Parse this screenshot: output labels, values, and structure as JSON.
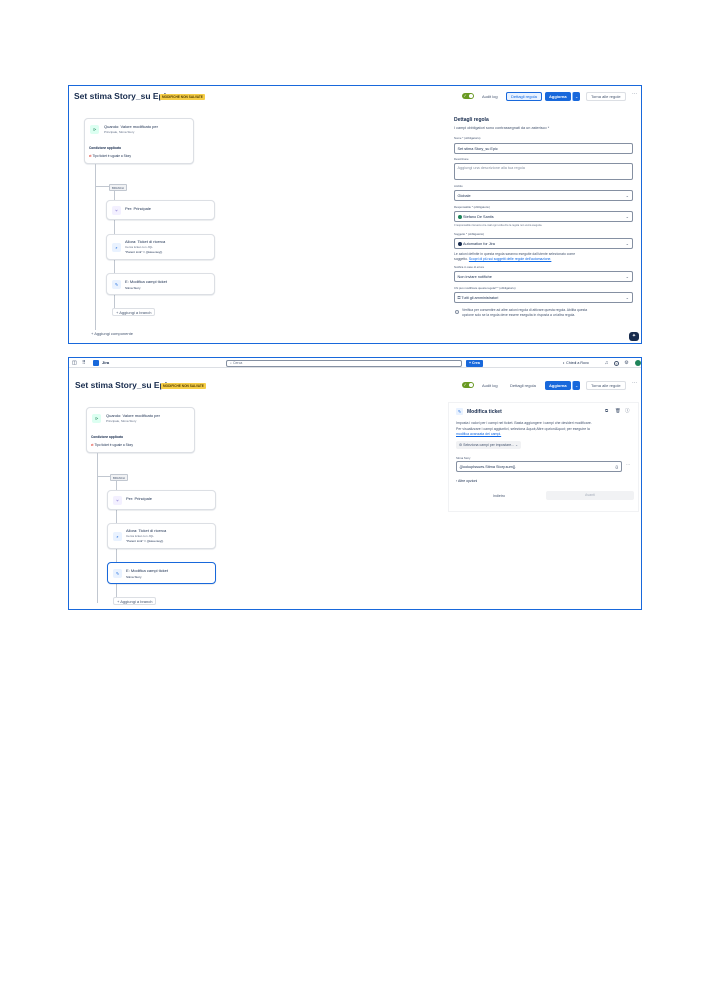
{
  "colors": {
    "accent": "#1868db",
    "brand_yellow": "#f5cd47",
    "toggle_on": "#6a9a23",
    "text": "#172b4d"
  },
  "rule": {
    "title": "Set stima Story_su Epic",
    "badge": "MODIFICHE NON SALVATE"
  },
  "header": {
    "audit_log": "Audit log",
    "details": "Dettagli regola",
    "update": "Aggiorna",
    "back": "Torna alle regole"
  },
  "flow": {
    "trigger_title": "Quando: Valore modificato per",
    "trigger_sub": "Principale, Stima Story",
    "trigger_sub_2": "Principale, Stima Story",
    "condition_label": "Condizione applicata",
    "condition_text": "Tipo ticket è uguale a Story",
    "branch_tag": "BRANCH",
    "branch_for": "Per: Principale",
    "search_title": "Allora: Ticket di ricerca",
    "search_sub": "Cerca ticket con JQL",
    "search_jql": "\"Parent Link\" = {{issue.key}}",
    "edit_title": "E: Modifica campi ticket",
    "edit_sub": "Stima Story",
    "add_branch": "Aggiungi a branch",
    "add_component": "Aggiungi componente"
  },
  "details_panel": {
    "title": "Dettagli regola",
    "required_note": "I campi obbligatori sono contrassegnati da un asterisco *",
    "name_label": "Nome * (obbligatorio)",
    "name_value": "Set stima Story_su Epic",
    "desc_label": "Descrizione",
    "desc_placeholder": "Aggiungi una descrizione alla tua regola",
    "scope_label": "Ambito",
    "scope_value": "Globale",
    "owner_label": "Responsabile * (obbligatorio)",
    "owner_value": "Stefano De Santis",
    "owner_help": "Il responsabile riceverà un'e-mail ogni volta che la regola non verrà eseguita.",
    "actor_label": "Soggetto * (obbligatorio)",
    "actor_value": "Automation for Jira",
    "actor_help_1": "Le azioni definite in questa regola saranno eseguite dall'utente selezionato come",
    "actor_help_2_prefix": "soggetto.",
    "actor_help_link": "Scopri di più sui soggetti delle regole dell'automazione.",
    "notify_label": "Notifica in caso di errore",
    "notify_value": "Non inviare notifiche",
    "who_label": "Chi può modificare questa regola? * (obbligatorio)",
    "who_value": "Tutti gli amministratori",
    "check_1": "Verifica per consentire ad altre azioni regola di attivare questa regola. Abilita questa",
    "check_2": "opzione solo se la regola deve essere eseguita in risposta a un'altra regola."
  },
  "nav": {
    "product": "Jira",
    "search_placeholder": "Cerca",
    "create": "+ Crea",
    "chiedi": "Chiedi a Rovo"
  },
  "edit_panel": {
    "title": "Modifica ticket",
    "desc_1": "Imposta i valori per i campi nel ticket. Basta aggiungere i campi che desideri modificare.",
    "desc_2": "Per visualizzare i campi aggiuntivi, seleziona &quot;Altre opzioni&quot; per eseguire la",
    "desc_link": "modifica avanzata dei campi.",
    "select_fields": "Seleziona campi per impostare...",
    "field_label": "Stima Story",
    "field_value": "{{lookupIssues.Stima Story.sum}}",
    "more_options": "Altre opzioni",
    "back": "Indietro",
    "next": "Avanti"
  }
}
